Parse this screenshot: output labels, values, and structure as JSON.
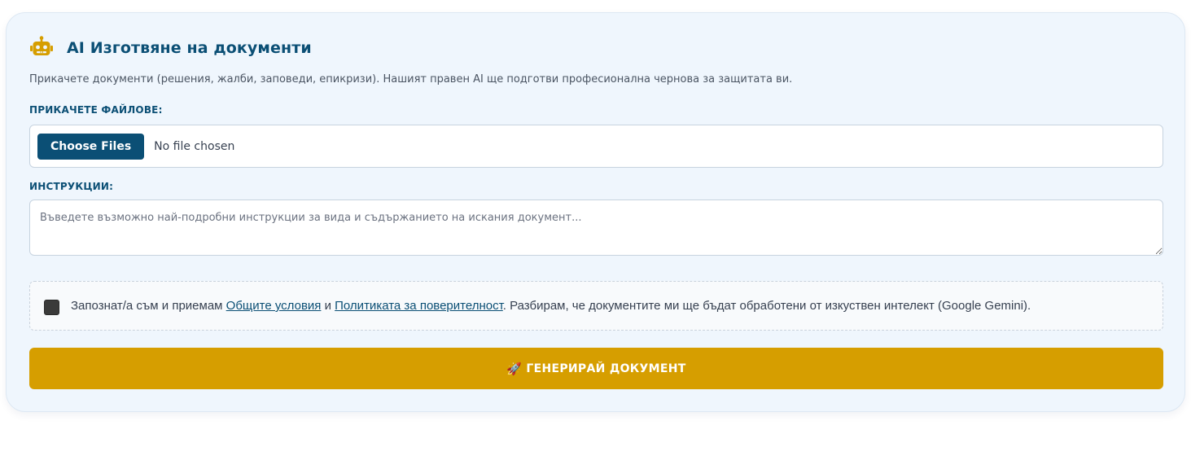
{
  "header": {
    "icon": "robot-icon",
    "title": "AI Изготвяне на документи"
  },
  "description": "Прикачете документи (решения, жалби, заповеди, епикризи). Нашият правен AI ще подготви професионална чернова за защитата ви.",
  "files": {
    "label": "ПРИКАЧЕТЕ ФАЙЛОВЕ:",
    "button_label": "Choose Files",
    "status": "No file chosen"
  },
  "instructions": {
    "label": "ИНСТРУКЦИИ:",
    "value": "",
    "placeholder": "Въведете възможно най-подробни инструкции за вида и съдържанието на искания документ..."
  },
  "consent": {
    "checked": false,
    "text_before": "Запознат/а съм и приемам ",
    "terms_link": "Общите условия",
    "text_and": " и ",
    "privacy_link": "Политиката за поверителност",
    "text_after": ". Разбирам, че документите ми ще бъдат обработени от изкуствен интелект (Google Gemini)."
  },
  "generate": {
    "icon": "rocket-icon",
    "icon_glyph": "🚀",
    "label": "ГЕНЕРИРАЙ ДОКУМЕНТ"
  },
  "colors": {
    "primary": "#0b4f75",
    "accent": "#d69e00",
    "card_background": "#eff6fd",
    "icon": "#d69e00"
  }
}
